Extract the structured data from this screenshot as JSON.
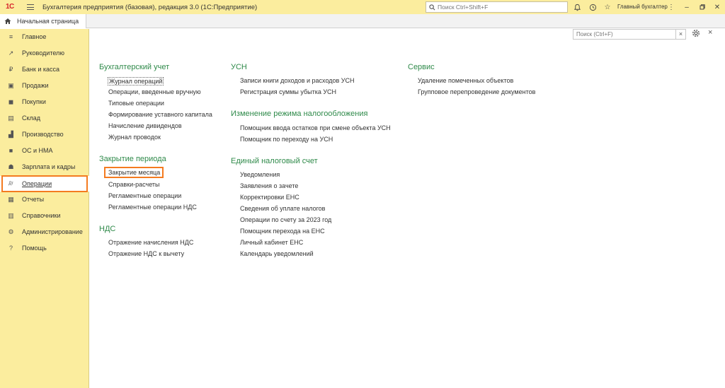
{
  "titlebar": {
    "logo_text": "1С",
    "title": "Бухгалтерия предприятия (базовая), редакция 3.0  (1С:Предприятие)",
    "search_placeholder": "Поиск Ctrl+Shift+F",
    "user": "Главный бухгалтер",
    "icons": [
      "bell-icon",
      "history-icon",
      "star-icon",
      "menu-icon",
      "minimize-icon",
      "maximize-icon",
      "close-icon"
    ]
  },
  "tabs": {
    "home": "Начальная страница"
  },
  "sidebar": {
    "items": [
      {
        "label": "Главное",
        "icon": "≡"
      },
      {
        "label": "Руководителю",
        "icon": "↗"
      },
      {
        "label": "Банк и касса",
        "icon": "₽"
      },
      {
        "label": "Продажи",
        "icon": "▣"
      },
      {
        "label": "Покупки",
        "icon": "◼"
      },
      {
        "label": "Склад",
        "icon": "▤"
      },
      {
        "label": "Производство",
        "icon": "▟"
      },
      {
        "label": "ОС и НМА",
        "icon": "■"
      },
      {
        "label": "Зарплата и кадры",
        "icon": "☗"
      },
      {
        "label": "Операции",
        "icon": "Дт"
      },
      {
        "label": "Отчеты",
        "icon": "▦"
      },
      {
        "label": "Справочники",
        "icon": "▥"
      },
      {
        "label": "Администрирование",
        "icon": "⚙"
      },
      {
        "label": "Помощь",
        "icon": "?"
      }
    ],
    "active_index": 9
  },
  "content": {
    "search_placeholder": "Поиск (Ctrl+F)",
    "clear_label": "×",
    "close_label": "×",
    "sections": {
      "accounting": {
        "title": "Бухгалтерский учет",
        "links": [
          "Журнал операций",
          "Операции, введенные вручную",
          "Типовые операции",
          "Формирование уставного капитала",
          "Начисление дивидендов",
          "Журнал проводок"
        ]
      },
      "period_close": {
        "title": "Закрытие периода",
        "links": [
          "Закрытие месяца",
          "Справки-расчеты",
          "Регламентные операции",
          "Регламентные операции НДС"
        ]
      },
      "vat": {
        "title": "НДС",
        "links": [
          "Отражение начисления НДС",
          "Отражение НДС к вычету"
        ]
      },
      "usn": {
        "title": "УСН",
        "links": [
          "Записи книги доходов и расходов УСН",
          "Регистрация суммы убытка УСН"
        ]
      },
      "tax_mode": {
        "title": "Изменение режима налогообложения",
        "links": [
          "Помощник ввода остатков при смене объекта УСН",
          "Помощник по переходу на УСН"
        ]
      },
      "ens": {
        "title": "Единый налоговый счет",
        "links": [
          "Уведомления",
          "Заявления о зачете",
          "Корректировки ЕНС",
          "Сведения об уплате налогов",
          "Операции по счету за 2023 год",
          "Помощник перехода на ЕНС",
          "Личный кабинет ЕНС",
          "Календарь уведомлений"
        ]
      },
      "service": {
        "title": "Сервис",
        "links": [
          "Удаление помеченных объектов",
          "Групповое перепроведение документов"
        ]
      }
    }
  }
}
